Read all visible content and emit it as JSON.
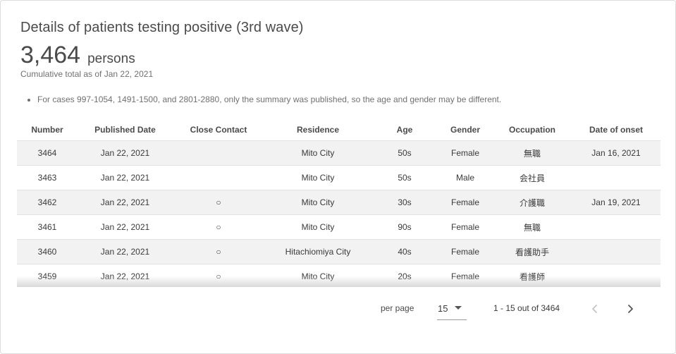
{
  "header": {
    "title": "Details of patients testing positive (3rd wave)",
    "total_count": "3,464",
    "total_unit": "persons",
    "cumulative_note": "Cumulative total as of Jan 22, 2021"
  },
  "notes": [
    "For cases 997-1054, 1491-1500, and 2801-2880, only the summary was published, so the age and gender may be different."
  ],
  "table": {
    "columns": [
      "Number",
      "Published Date",
      "Close Contact",
      "Residence",
      "Age",
      "Gender",
      "Occupation",
      "Date of onset"
    ],
    "rows": [
      [
        "3464",
        "Jan 22, 2021",
        "",
        "Mito City",
        "50s",
        "Female",
        "無職",
        "Jan 16, 2021"
      ],
      [
        "3463",
        "Jan 22, 2021",
        "",
        "Mito City",
        "50s",
        "Male",
        "会社員",
        ""
      ],
      [
        "3462",
        "Jan 22, 2021",
        "○",
        "Mito City",
        "30s",
        "Female",
        "介護職",
        "Jan 19, 2021"
      ],
      [
        "3461",
        "Jan 22, 2021",
        "○",
        "Mito City",
        "90s",
        "Female",
        "無職",
        ""
      ],
      [
        "3460",
        "Jan 22, 2021",
        "○",
        "Hitachiomiya City",
        "40s",
        "Female",
        "看護助手",
        ""
      ],
      [
        "3459",
        "Jan 22, 2021",
        "○",
        "Mito City",
        "20s",
        "Female",
        "看護師",
        ""
      ]
    ]
  },
  "pagination": {
    "per_page_label": "per page",
    "per_page_value": "15",
    "range_text": "1 - 15 out of 3464",
    "icons": {
      "prev": "chevron-left-icon",
      "next": "chevron-right-icon",
      "dropdown": "caret-down-icon"
    },
    "colors": {
      "prev_disabled": "#c4c4c4",
      "next_enabled": "#555555"
    }
  }
}
